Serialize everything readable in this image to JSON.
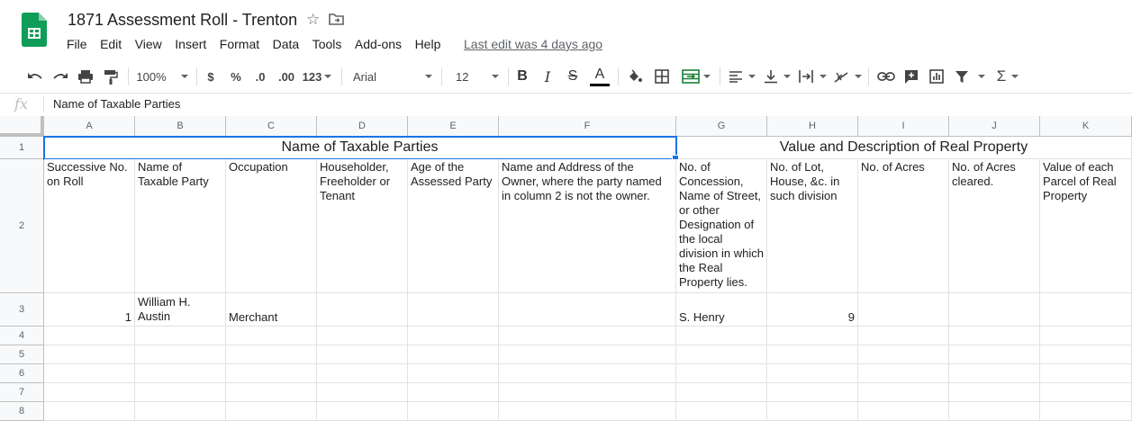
{
  "header": {
    "doc_title": "1871 Assessment Roll - Trenton",
    "last_edit": "Last edit was 4 days ago",
    "menu": [
      "File",
      "Edit",
      "View",
      "Insert",
      "Format",
      "Data",
      "Tools",
      "Add-ons",
      "Help"
    ]
  },
  "toolbar": {
    "zoom": "100%",
    "currency": "$",
    "percent": "%",
    "dec_decrease": ".0",
    "dec_increase": ".00",
    "more_formats": "123",
    "font": "Arial",
    "font_size": "12",
    "bold": "B",
    "italic": "I",
    "strike": "S",
    "text_color": "A"
  },
  "formula_bar": {
    "fx": "fx",
    "value": "Name of Taxable Parties"
  },
  "columns": [
    "A",
    "B",
    "C",
    "D",
    "E",
    "F",
    "G",
    "H",
    "I",
    "J",
    "K"
  ],
  "rows": [
    "1",
    "2",
    "3",
    "4",
    "5",
    "6",
    "7",
    "8"
  ],
  "cells": {
    "r1_a_f": "Name of Taxable Parties",
    "r1_g_k": "Value and Description of Real Property",
    "r2": {
      "a": "Successive No. on Roll",
      "b": "Name of Taxable Party",
      "c": "Occupation",
      "d": "Householder, Freeholder or Tenant",
      "e": "Age of the Assessed Party",
      "f": "Name and Address of the Owner, where the party named in column 2 is not the owner.",
      "g": "No. of Concession, Name of Street, or other Designation of the local division in which the Real Property lies.",
      "h": "No. of Lot, House, &c. in such division",
      "i": "No. of Acres",
      "j": "No. of Acres cleared.",
      "k": "Value of each Parcel of Real Property"
    },
    "r3": {
      "a": "1",
      "b": "William H. Austin",
      "c": "Merchant",
      "g": "S. Henry",
      "h": "9"
    }
  },
  "colors": {
    "accent": "#1a73e8",
    "sheets_green": "#0f9d58"
  }
}
